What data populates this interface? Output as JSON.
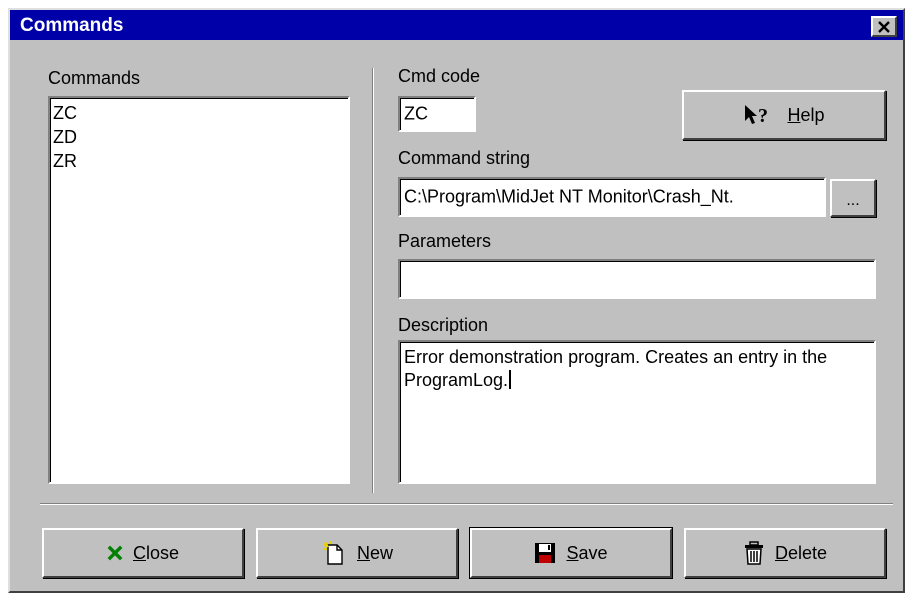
{
  "window": {
    "title": "Commands"
  },
  "commands_list": {
    "label": "Commands",
    "items": [
      "ZC",
      "ZD",
      "ZR"
    ]
  },
  "cmd_code": {
    "label": "Cmd code",
    "value": "ZC"
  },
  "command_string": {
    "label": "Command string",
    "value": "C:\\Program\\MidJet NT Monitor\\Crash_Nt.",
    "browse_label": "..."
  },
  "parameters": {
    "label": "Parameters",
    "value": ""
  },
  "description": {
    "label": "Description",
    "value": "Error demonstration program. Creates an entry in the ProgramLog."
  },
  "buttons": {
    "help": {
      "first": "H",
      "rest": "elp",
      "icon": "help-arrow-icon"
    },
    "close": {
      "first": "C",
      "rest": "lose",
      "icon": "green-x-icon"
    },
    "new": {
      "first": "N",
      "rest": "ew",
      "icon": "new-document-icon"
    },
    "save": {
      "first": "S",
      "rest": "ave",
      "icon": "floppy-disk-icon"
    },
    "delete": {
      "first": "D",
      "rest": "elete",
      "icon": "trash-can-icon"
    }
  },
  "colors": {
    "titlebar": "#0000a8",
    "face": "#c0c0c0",
    "close_icon": "#008000"
  }
}
